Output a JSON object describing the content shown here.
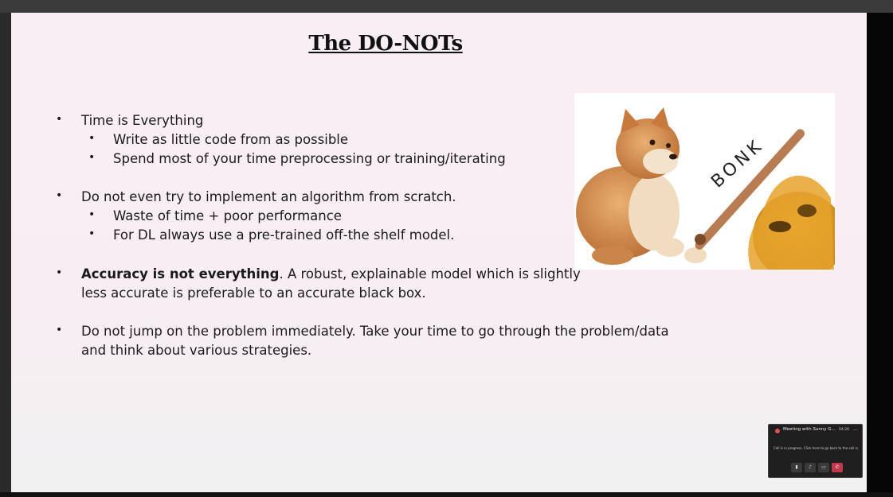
{
  "slide": {
    "title": "The DO-NOTs",
    "bullets": [
      {
        "text": "Time is Everything",
        "sub": [
          "Write as little code from as possible",
          "Spend most of your time preprocessing or training/iterating"
        ]
      },
      {
        "text": "Do not even try to implement an algorithm from scratch.",
        "sub": [
          "Waste of time + poor performance",
          "For DL always use a pre-trained off-the shelf model."
        ]
      },
      {
        "bold": "Accuracy is not everything",
        "line1_rest": ". A robust, explainable model which is slightly",
        "line2": "less accurate is preferable to an accurate black box."
      },
      {
        "line1": "Do not jump on the problem immediately. Take your time to go through the problem/data",
        "line2": "and think about various strategies."
      }
    ],
    "meme": {
      "caption": "BONK"
    }
  },
  "call_window": {
    "title": "Meeting with Sunny G...",
    "timer": "04:26",
    "more_label": "...",
    "message": "Call is in progress. Click here to go back to the call screen.",
    "buttons": [
      "camera-icon",
      "mic-icon",
      "screen-share-icon",
      "end-call-icon"
    ],
    "end_color": "#c0394b"
  }
}
